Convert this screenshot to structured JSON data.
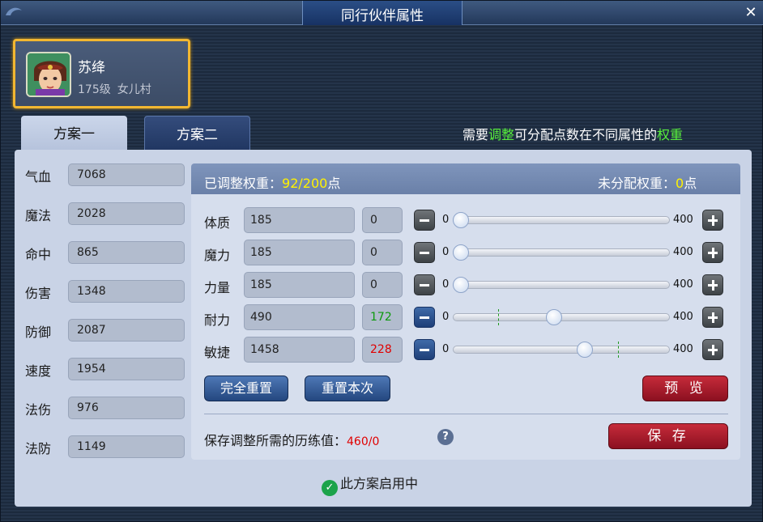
{
  "window": {
    "title": "同行伙伴属性",
    "close_label": "✕"
  },
  "character": {
    "name": "苏绛",
    "level": "175级",
    "school": "女儿村"
  },
  "tabs": [
    {
      "label": "方案一"
    },
    {
      "label": "方案二"
    }
  ],
  "hint": {
    "part1": "需要",
    "part2": "调整",
    "part3": "可分配点数在不同属性的",
    "part4": "权重"
  },
  "stats": [
    {
      "label": "气血",
      "value": "7068"
    },
    {
      "label": "魔法",
      "value": "2028"
    },
    {
      "label": "命中",
      "value": "865"
    },
    {
      "label": "伤害",
      "value": "1348"
    },
    {
      "label": "防御",
      "value": "2087"
    },
    {
      "label": "速度",
      "value": "1954"
    },
    {
      "label": "法伤",
      "value": "976"
    },
    {
      "label": "法防",
      "value": "1149"
    }
  ],
  "weights": {
    "adjusted_label": "已调整权重：",
    "adjusted_value": "92/200",
    "adjusted_unit": "点",
    "unassigned_label": "未分配权重：",
    "unassigned_value": "0",
    "unassigned_unit": "点"
  },
  "attributes": [
    {
      "label": "体质",
      "value": "185",
      "added": "0",
      "min": "0",
      "max": "400",
      "level": 0.0,
      "marker": 0.0
    },
    {
      "label": "魔力",
      "value": "185",
      "added": "0",
      "min": "0",
      "max": "400",
      "level": 0.0,
      "marker": 0.0
    },
    {
      "label": "力量",
      "value": "185",
      "added": "0",
      "min": "0",
      "max": "400",
      "level": 0.0,
      "marker": 0.0
    },
    {
      "label": "耐力",
      "value": "490",
      "added": "172",
      "min": "0",
      "max": "400",
      "level": 0.43,
      "marker": 0.21
    },
    {
      "label": "敏捷",
      "value": "1458",
      "added": "228",
      "min": "0",
      "max": "400",
      "level": 0.57,
      "marker": 0.76
    }
  ],
  "buttons": {
    "reset_all": "完全重置",
    "reset_this": "重置本次",
    "preview": "预 览",
    "save": "保 存"
  },
  "save_cost": {
    "label": "保存调整所需的历练值：",
    "value": "460/0"
  },
  "status": {
    "text": "此方案启用中"
  },
  "colors": {
    "accent_green": "#58f03c",
    "highlight_yellow": "#fff200",
    "warn_red": "#e00000",
    "card_border": "#f2b731"
  }
}
